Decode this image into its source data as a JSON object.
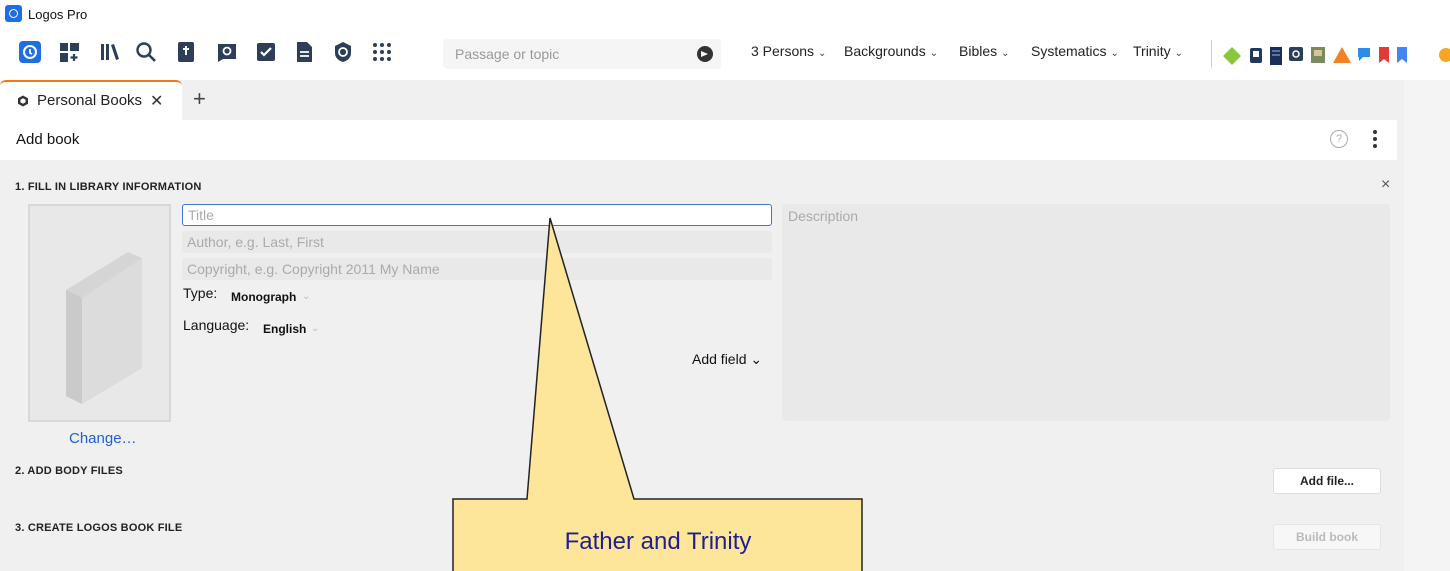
{
  "app": {
    "title": "Logos Pro"
  },
  "toolbar": {
    "search_placeholder": "Passage or topic",
    "layouts": [
      {
        "label": "3 Persons"
      },
      {
        "label": "Backgrounds"
      },
      {
        "label": "Bibles"
      },
      {
        "label": "Systematics"
      },
      {
        "label": "Trinity"
      }
    ],
    "chevron": "⌄"
  },
  "tab": {
    "label": "Personal Books",
    "close": "✕",
    "add": "+"
  },
  "panel": {
    "title": "Add book",
    "help": "?"
  },
  "section1": {
    "title": "1. FILL IN LIBRARY INFORMATION",
    "close": "×",
    "title_placeholder": "Title",
    "author_placeholder": "Author, e.g. Last, First",
    "copyright_placeholder": "Copyright, e.g. Copyright 2011 My Name",
    "type_label": "Type:",
    "type_value": "Monograph",
    "language_label": "Language:",
    "language_value": "English",
    "add_field": "Add field ⌄",
    "description_placeholder": "Description",
    "change_link": "Change…"
  },
  "section2": {
    "title": "2. ADD BODY FILES",
    "button": "Add file..."
  },
  "section3": {
    "title": "3. CREATE LOGOS BOOK FILE",
    "button": "Build book"
  },
  "callout": {
    "text": "Father and Trinity",
    "fill": "#fde59a",
    "stroke": "#222222"
  },
  "colors": {
    "accent": "#1e6fe0",
    "tab_highlight": "#f07a1a",
    "link": "#1a62d6"
  }
}
